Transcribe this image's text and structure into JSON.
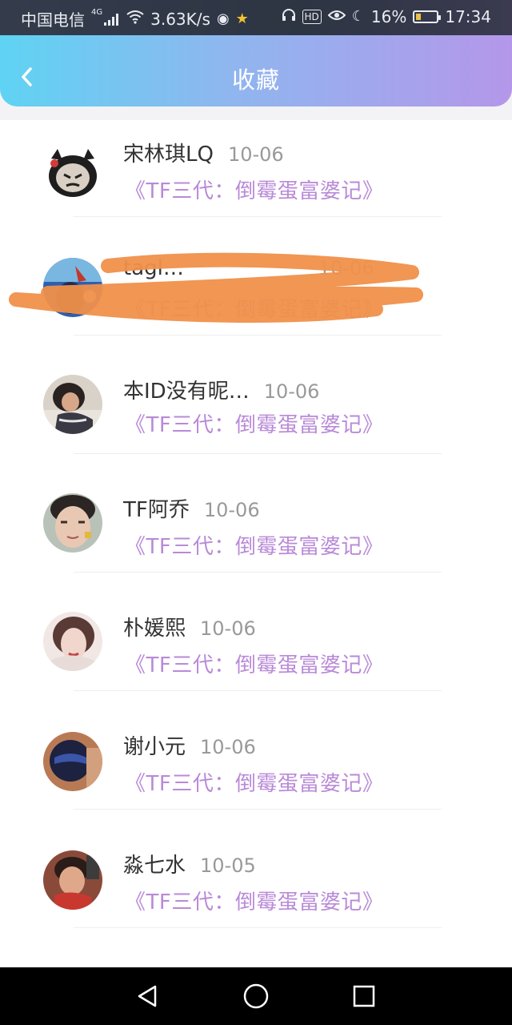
{
  "status_bar": {
    "carrier": "中国电信",
    "network": "4G",
    "speed": "3.63K/s",
    "battery": "16%",
    "time": "17:34",
    "icons": [
      "signal-icon",
      "wifi-icon",
      "globe-icon",
      "star-icon",
      "headset-icon",
      "hd-icon",
      "eye-icon",
      "moon-icon",
      "battery-icon"
    ]
  },
  "header": {
    "title": "收藏",
    "back_icon": "chevron-left-icon"
  },
  "items": [
    {
      "name": "宋林琪LQ",
      "date": "10-06",
      "work": "《TF三代：倒霉蛋富婆记》"
    },
    {
      "name": "tagl…",
      "date": "10-06",
      "work": "《TF三代：倒霉蛋富婆记》"
    },
    {
      "name": "本ID没有昵…",
      "date": "10-06",
      "work": "《TF三代：倒霉蛋富婆记》"
    },
    {
      "name": "TF阿乔",
      "date": "10-06",
      "work": "《TF三代：倒霉蛋富婆记》"
    },
    {
      "name": "朴媛熙",
      "date": "10-06",
      "work": "《TF三代：倒霉蛋富婆记》"
    },
    {
      "name": "谢小元",
      "date": "10-06",
      "work": "《TF三代：倒霉蛋富婆记》"
    },
    {
      "name": "淼七水",
      "date": "10-05",
      "work": "《TF三代：倒霉蛋富婆记》"
    }
  ],
  "colors": {
    "header_gradient": [
      "#5fd3f3",
      "#b497ea"
    ],
    "accent_title": "#b98ad8",
    "scribble": "#f0904a"
  },
  "nav_bar": {
    "icons": [
      "back-triangle-icon",
      "home-circle-icon",
      "recents-square-icon"
    ]
  }
}
